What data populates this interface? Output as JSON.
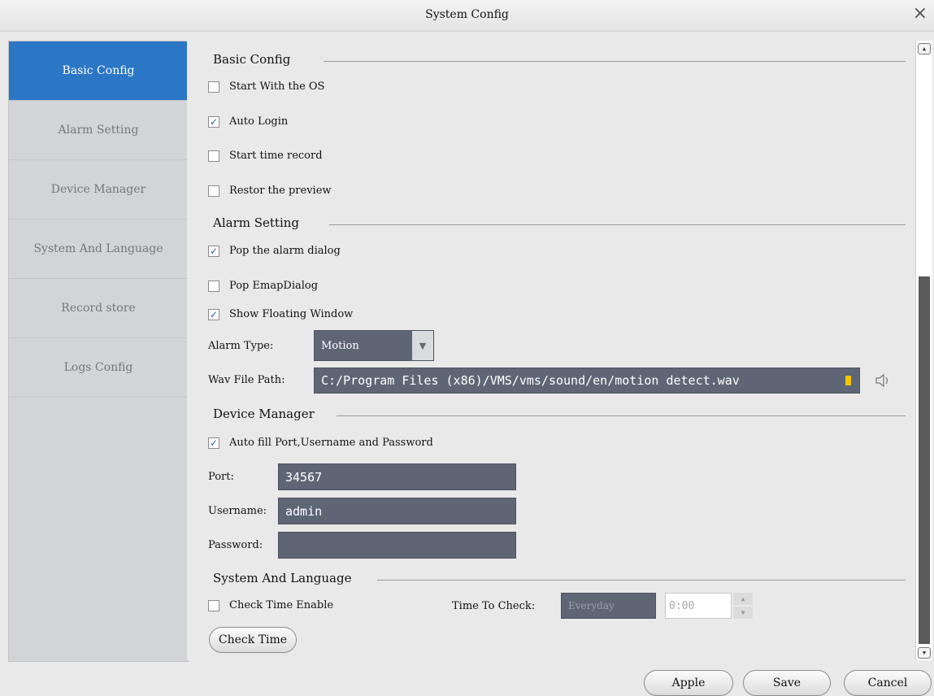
{
  "window": {
    "title": "System Config",
    "close_glyph": "×"
  },
  "sidebar": {
    "items": [
      {
        "label": "Basic Config",
        "active": true
      },
      {
        "label": "Alarm Setting",
        "active": false
      },
      {
        "label": "Device Manager",
        "active": false
      },
      {
        "label": "System And Language",
        "active": false
      },
      {
        "label": "Record store",
        "active": false
      },
      {
        "label": "Logs Config",
        "active": false
      }
    ]
  },
  "basic_config": {
    "heading": "Basic Config",
    "start_with_os": {
      "label": "Start With the OS",
      "checked": false
    },
    "auto_login": {
      "label": "Auto Login",
      "checked": true
    },
    "start_time_record": {
      "label": "Start time record",
      "checked": false
    },
    "restore_preview": {
      "label": "Restor the preview",
      "checked": false
    }
  },
  "alarm_setting": {
    "heading": "Alarm Setting",
    "pop_alarm_dialog": {
      "label": "Pop the alarm dialog",
      "checked": true
    },
    "pop_emap_dialog": {
      "label": "Pop EmapDialog",
      "checked": false
    },
    "show_floating_window": {
      "label": "Show Floating Window",
      "checked": true
    },
    "alarm_type_label": "Alarm Type:",
    "alarm_type_value": "Motion",
    "wav_path_label": "Wav File Path:",
    "wav_path_value": "C:/Program Files (x86)/VMS/vms/sound/en/motion detect.wav"
  },
  "device_manager": {
    "heading": "Device Manager",
    "auto_fill": {
      "label": "Auto fill Port,Username and Password",
      "checked": true
    },
    "port_label": "Port:",
    "port_value": "34567",
    "username_label": "Username:",
    "username_value": "admin",
    "password_label": "Password:",
    "password_value": ""
  },
  "system_language": {
    "heading": "System And Language",
    "check_time_enable": {
      "label": "Check Time Enable",
      "checked": false
    },
    "time_to_check_label": "Time To Check:",
    "time_to_check_value": "Everyday",
    "time_value": "0:00",
    "check_time_button": "Check Time"
  },
  "footer": {
    "apply_label": "Apple",
    "save_label": "Save",
    "cancel_label": "Cancel"
  },
  "colors": {
    "accent": "#2b77c5",
    "field_bg": "#5e6675"
  },
  "check_glyph": "✓"
}
